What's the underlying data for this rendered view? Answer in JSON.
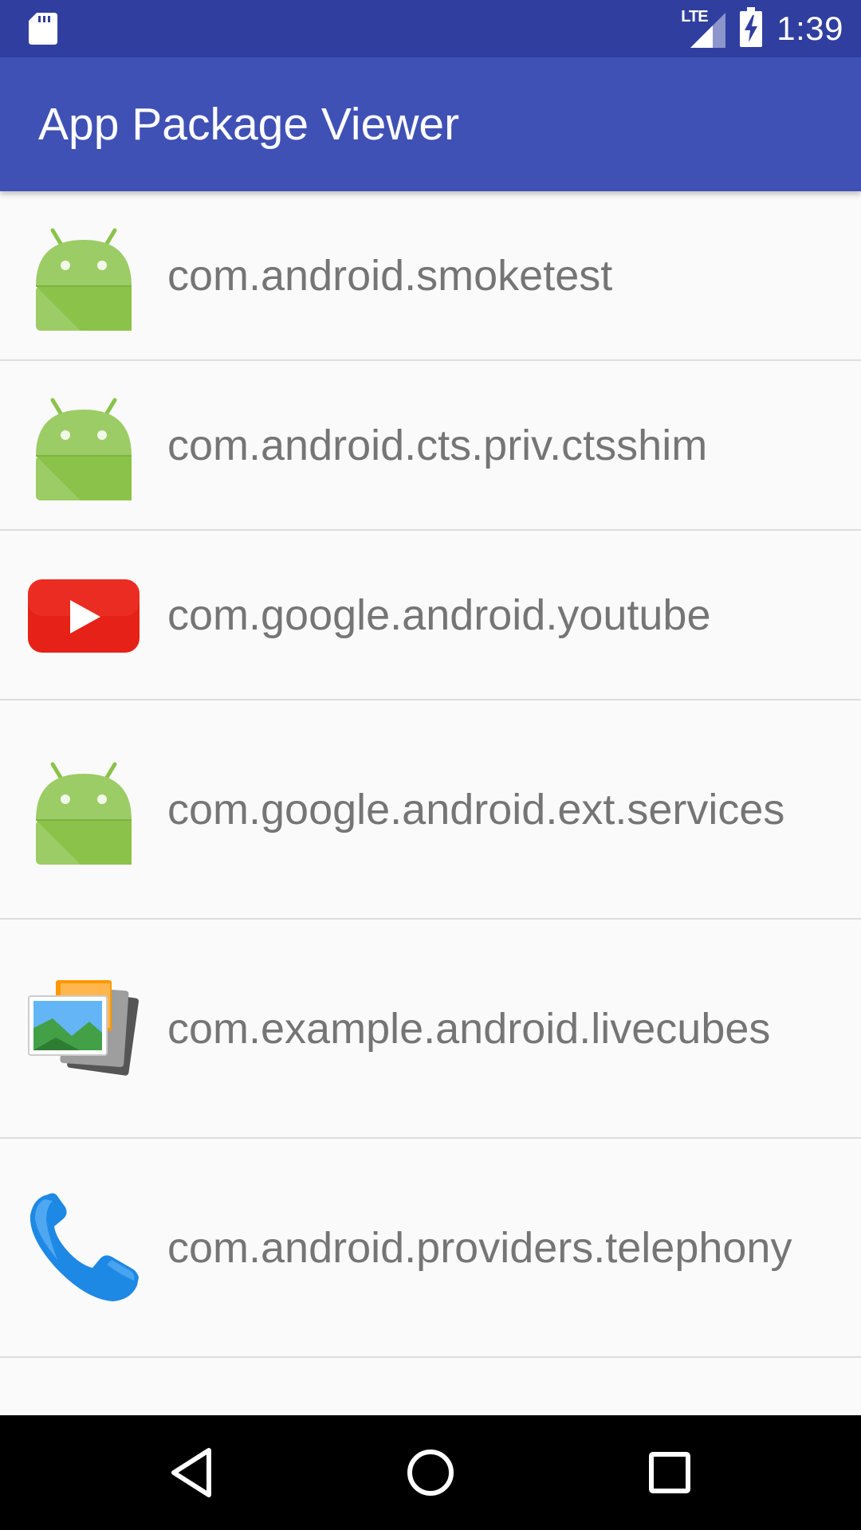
{
  "status_bar": {
    "time": "1:39",
    "network": "LTE",
    "left_icon": "sd-card-icon",
    "signal_icon": "signal-icon",
    "battery_icon": "battery-charging-icon"
  },
  "app_bar": {
    "title": "App Package Viewer",
    "background": "#3f51b5",
    "status_background": "#303f9f"
  },
  "packages": [
    {
      "name": "com.android.smoketest",
      "icon": "android-robot-icon"
    },
    {
      "name": "com.android.cts.priv.ctsshim",
      "icon": "android-robot-icon"
    },
    {
      "name": "com.google.android.youtube",
      "icon": "youtube-icon"
    },
    {
      "name": "com.google.android.ext.services",
      "icon": "android-robot-icon"
    },
    {
      "name": "com.example.android.livecubes",
      "icon": "gallery-icon"
    },
    {
      "name": "com.android.providers.telephony",
      "icon": "phone-icon"
    }
  ],
  "nav_bar": {
    "back_icon": "back-icon",
    "home_icon": "home-icon",
    "recents_icon": "recents-icon"
  }
}
